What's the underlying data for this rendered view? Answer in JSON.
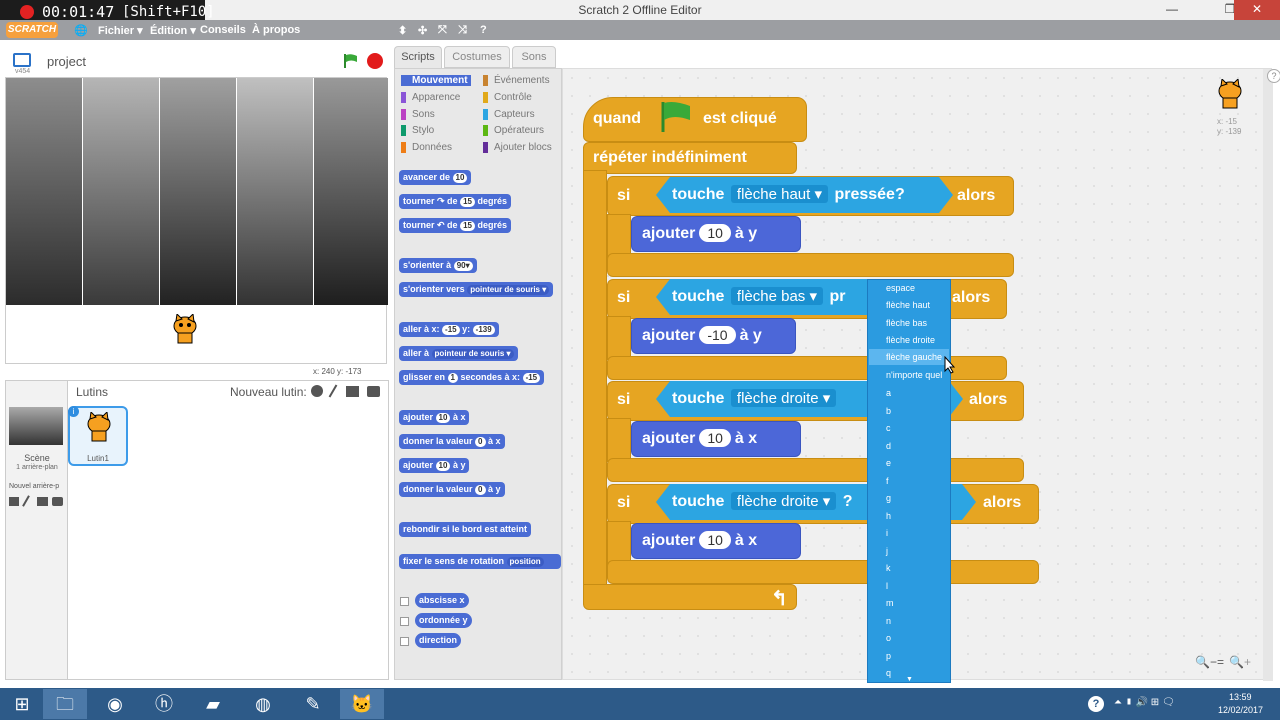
{
  "window": {
    "title": "Scratch 2 Offline Editor",
    "minimize": "—",
    "restore": "❐",
    "close": "✕"
  },
  "recorder": {
    "time": "00:01:47",
    "shortcut": "[Shift+F10]"
  },
  "menubar": {
    "logo": "SCRATCH",
    "globe": "🌐",
    "items": [
      "Fichier ▾",
      "Édition ▾",
      "Conseils",
      "À propos"
    ],
    "tools": [
      "⬍",
      "✣",
      "⤧",
      "⤨",
      "?"
    ]
  },
  "stage": {
    "project_name": "project",
    "version": "v454",
    "coords": "x: 240   y: -173"
  },
  "sprites": {
    "header": "Lutins",
    "new_sprite_label": "Nouveau lutin:",
    "scene_label": "Scène",
    "scene_sub": "1 arrière-plan",
    "new_backdrop": "Nouvel arrière-p",
    "sprite_name": "Lutin1",
    "info": "i"
  },
  "tabs": [
    "Scripts",
    "Costumes",
    "Sons"
  ],
  "categories": {
    "left": [
      "Mouvement",
      "Apparence",
      "Sons",
      "Stylo",
      "Données"
    ],
    "right": [
      "Événements",
      "Contrôle",
      "Capteurs",
      "Opérateurs",
      "Ajouter blocs"
    ],
    "colors": {
      "Mouvement": "#4a6cd4",
      "Apparence": "#8a55d7",
      "Sons": "#bb42c3",
      "Stylo": "#0e9a6c",
      "Données": "#ee7d16",
      "Événements": "#c88330",
      "Contrôle": "#e1a91a",
      "Capteurs": "#2ca5e2",
      "Opérateurs": "#5cb712",
      "Ajouter blocs": "#632d99"
    }
  },
  "palette_blocks": [
    {
      "text": "avancer de",
      "arg": "10"
    },
    {
      "text": "tourner ↷ de",
      "arg": "15",
      "suffix": "degrés"
    },
    {
      "text": "tourner ↶ de",
      "arg": "15",
      "suffix": "degrés"
    },
    {
      "text": "s'orienter à",
      "arg": "90▾"
    },
    {
      "text": "s'orienter vers",
      "arg": "pointeur de souris ▾"
    },
    {
      "text": "aller à x:",
      "arg": "-15",
      "suffix": "y:",
      "arg2": "-139"
    },
    {
      "text": "aller à",
      "arg": "pointeur de souris ▾"
    },
    {
      "text": "glisser en",
      "arg": "1",
      "suffix": "secondes à x:",
      "arg2": "-15"
    },
    {
      "text": "ajouter",
      "arg": "10",
      "suffix": "à x"
    },
    {
      "text": "donner la valeur",
      "arg": "0",
      "suffix": "à x"
    },
    {
      "text": "ajouter",
      "arg": "10",
      "suffix": "à y"
    },
    {
      "text": "donner la valeur",
      "arg": "0",
      "suffix": "à y"
    },
    {
      "text": "rebondir si le bord est atteint"
    },
    {
      "text": "fixer le sens de rotation",
      "arg": "position"
    },
    {
      "text": "abscisse x"
    },
    {
      "text": "ordonnée y"
    },
    {
      "text": "direction"
    }
  ],
  "script": {
    "hat": {
      "a": "quand",
      "b": "est cliqué"
    },
    "forever": "répéter indéfiniment",
    "ifs": [
      {
        "si": "si",
        "touche": "touche",
        "key": "flèche haut",
        "pressed": "pressée?",
        "alors": "alors",
        "op": "ajouter",
        "val": "10",
        "axis": "à y"
      },
      {
        "si": "si",
        "touche": "touche",
        "key": "flèche bas",
        "pressed": "pr",
        "alors": "alors",
        "op": "ajouter",
        "val": "-10",
        "axis": "à y"
      },
      {
        "si": "si",
        "touche": "touche",
        "key": "flèche droite",
        "pressed": "",
        "alors": "alors",
        "op": "ajouter",
        "val": "10",
        "axis": "à x"
      },
      {
        "si": "si",
        "touche": "touche",
        "key": "flèche droite",
        "pressed": "?",
        "alors": "alors",
        "op": "ajouter",
        "val": "10",
        "axis": "à x"
      }
    ],
    "loop_arrow": "↰"
  },
  "sprite_info": {
    "x": "x: -15",
    "y": "y: -139"
  },
  "dropdown_options": [
    "espace",
    "flèche haut",
    "flèche bas",
    "flèche droite",
    "flèche gauche",
    "n'importe quel",
    "a",
    "b",
    "c",
    "d",
    "e",
    "f",
    "g",
    "h",
    "i",
    "j",
    "k",
    "l",
    "m",
    "n",
    "o",
    "p",
    "q"
  ],
  "dropdown_selected": "flèche gauche",
  "zoom": [
    "🔍−",
    "=",
    "🔍+"
  ],
  "taskbar": {
    "clock_time": "13:59",
    "clock_date": "12/02/2017",
    "help": "?",
    "tray": "⏶ ▮ 🔊 ⊞ 🗨"
  }
}
